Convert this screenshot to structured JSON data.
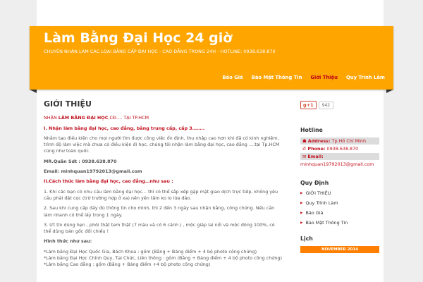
{
  "header": {
    "title": "Làm Bằng Đại Học 24 giờ",
    "description": "CHUYÊN NHẬN LÀM CÁC LOẠI BẰNG CẤP ĐẠI HỌC - CAO ĐẲNG TRONG 24H - HOTLINE: 0938.638.870"
  },
  "nav": {
    "items": [
      {
        "label": "Báo Giá"
      },
      {
        "label": "Bảo Mật Thông Tin"
      },
      {
        "label": "Giới Thiệu"
      },
      {
        "label": "Quy Trình Làm"
      }
    ]
  },
  "post": {
    "title": "GIỚI THIỆU",
    "line1_pre": "NHẬN ",
    "line1_bold": "LÀM BẰNG ĐẠI HỌC",
    "line1_post": ",CĐ…. TẠI TP.HCM",
    "section1": "I. Nhận làm bằng đại học, cao đẳng, bằng trung cấp, cấp 3……..",
    "para1": "Nhằm tạo điều kiện cho mọi người tìm được công việc ổn định, thu nhập cao hơn khi đã có kinh nghiệm, trình độ làm việc mà chưa có điều kiện đi học, chúng tôi nhận làm bằng đại học, cao đẳng ….tại Tp.HCM cũng như toàn quốc.",
    "contact_name": "MR.Quân     Sdt : 0938.638.870",
    "contact_email": "Email:      minhquan19792013@gmail.com",
    "section2": "II.Cách thức làm bằng đại học, cao đẳng…như sau :",
    "step1": "1. Khi các bạn có nhu cầu làm bằng đại học… thì có thể sắp xếp gặp mặt giao dịch trực tiếp, không yêu cầu phải đặt cọc (trừ trường hợp ở xa) nên yên tâm ko lo lừa đảo.",
    "step2": "2. Sau khi cung cấp đầy đủ thông tin cho mình, thì 2 đến 3 ngày sau nhận bằng, công chứng. Nếu cần làm nhanh có thể lấy trong 1 ngày.",
    "step3": "3. Ưt tín dùng hẹn , phôi thật tem thật (7 màu và có 6 cánh ) , mộc giáp lai nổi và mộc đóng 100%, có thể dùng bản gốc đối chiếu !",
    "form_title": "Hình thức như sau:",
    "form1": "*Làm bằng Đại Học Quốc Gia, Bách Khoa : gồm (Bằng + Bảng điểm + 4 bộ photo công chứng)",
    "form2": "*Làm bằng Đại Học Chính Quy, Tại Chức, Liên thông : gồm (Bằng + Bảng điểm + 4 bộ photo công chứng)",
    "form3": "*Làm bằng Cao đẳng : gồm (Bằng + Bảng điểm +4 bộ photo công chứng)"
  },
  "sidebar": {
    "gplus_label": "g+1",
    "gplus_count": "942",
    "hotline_title": "Hotline",
    "address_label": "Address:",
    "address_value": "Tp.Hồ Chí Minh",
    "phone_label": "Phone:",
    "phone_value": "0938.638.870",
    "email_label": "Email:",
    "email_value": "minhquan19792013@gmail.com",
    "rules_title": "Quy Định",
    "rules": [
      {
        "label": "GIỚI THIỆU"
      },
      {
        "label": "Quy Trình Làm"
      },
      {
        "label": "Báo Giá"
      },
      {
        "label": "Bảo Mật Thông Tin"
      }
    ],
    "calendar_title": "Lịch",
    "calendar_month": "NOVEMBER 2014"
  },
  "colors": {
    "header": "#ffa500",
    "accent_red": "#c1121f",
    "calendar": "#ff7f00"
  }
}
